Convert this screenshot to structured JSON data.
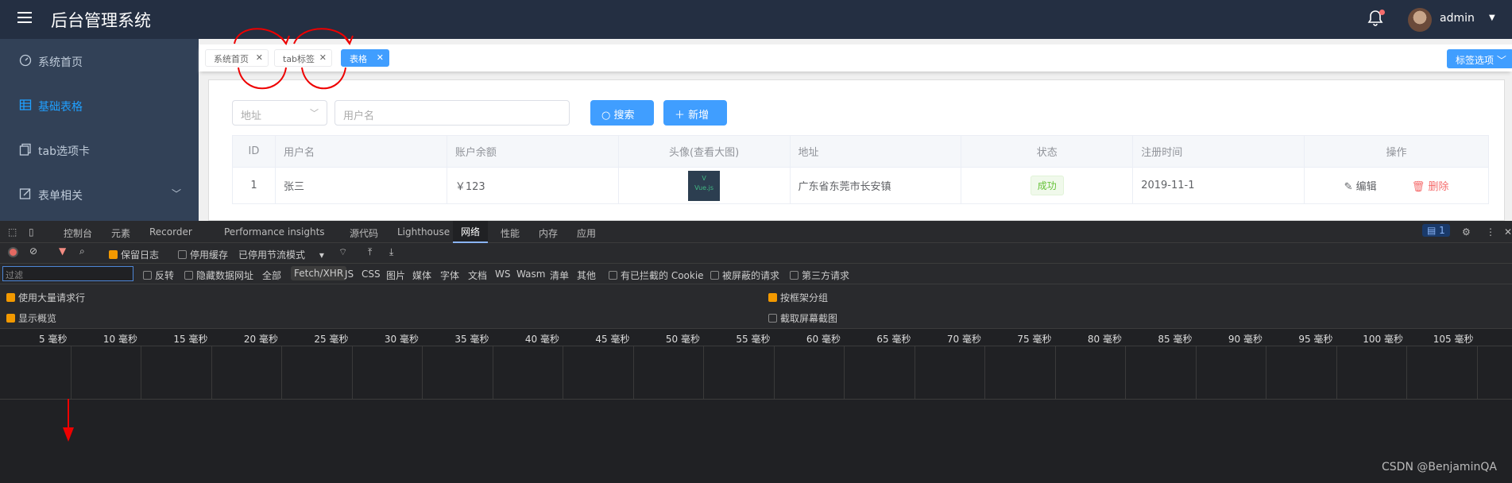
{
  "header": {
    "title": "后台管理系统",
    "username": "admin"
  },
  "sidebar": {
    "items": [
      {
        "label": "系统首页",
        "active": false
      },
      {
        "label": "基础表格",
        "active": true
      },
      {
        "label": "tab选项卡",
        "active": false
      },
      {
        "label": "表单相关",
        "active": false
      }
    ]
  },
  "tags": {
    "items": [
      {
        "label": "系统首页",
        "active": false
      },
      {
        "label": "tab标签",
        "active": false
      },
      {
        "label": "表格",
        "active": true
      }
    ],
    "options_label": "标签选项"
  },
  "search": {
    "address_placeholder": "地址",
    "username_placeholder": "用户名",
    "search_label": "搜索",
    "add_label": "新增"
  },
  "table": {
    "headers": [
      "ID",
      "用户名",
      "账户余额",
      "头像(查看大图)",
      "地址",
      "状态",
      "注册时间",
      "操作"
    ],
    "rows": [
      {
        "id": "1",
        "name": "张三",
        "balance": "￥123",
        "avatar_text": "Vue.js",
        "address": "广东省东莞市长安镇",
        "status": "成功",
        "date": "2019-11-1",
        "edit": "编辑",
        "delete": "删除"
      }
    ]
  },
  "devtools": {
    "tabs": [
      "控制台",
      "元素",
      "Recorder",
      "Performance insights",
      "源代码",
      "Lighthouse",
      "网络",
      "性能",
      "内存",
      "应用"
    ],
    "active_tab": "网络",
    "issues_count": "1",
    "toolbar": {
      "preserve_log": "保留日志",
      "disable_cache": "停用缓存",
      "throttle": "已停用节流模式"
    },
    "filter_placeholder": "过滤",
    "filter_row": {
      "invert": "反转",
      "hide_data_urls": "隐藏数据网址",
      "types": [
        "全部",
        "Fetch/XHR",
        "JS",
        "CSS",
        "图片",
        "媒体",
        "字体",
        "文档",
        "WS",
        "Wasm",
        "清单",
        "其他"
      ],
      "blocked_cookies": "有已拦截的 Cookie",
      "blocked_requests": "被屏蔽的请求",
      "third_party": "第三方请求"
    },
    "options": {
      "big_rows": "使用大量请求行",
      "group_by_frame": "按框架分组",
      "show_overview": "显示概览",
      "capture_screenshots": "截取屏幕截图"
    },
    "ruler_ticks": [
      "5 毫秒",
      "10 毫秒",
      "15 毫秒",
      "20 毫秒",
      "25 毫秒",
      "30 毫秒",
      "35 毫秒",
      "40 毫秒",
      "45 毫秒",
      "50 毫秒",
      "55 毫秒",
      "60 毫秒",
      "65 毫秒",
      "70 毫秒",
      "75 毫秒",
      "80 毫秒",
      "85 毫秒",
      "90 毫秒",
      "95 毫秒",
      "100 毫秒",
      "105 毫秒"
    ]
  },
  "watermark": "CSDN @BenjaminQA",
  "colors": {
    "header_bg": "#242f42",
    "sidebar_bg": "#324157",
    "accent": "#409eff",
    "danger": "#f56c6c",
    "success": "#67c23a"
  }
}
